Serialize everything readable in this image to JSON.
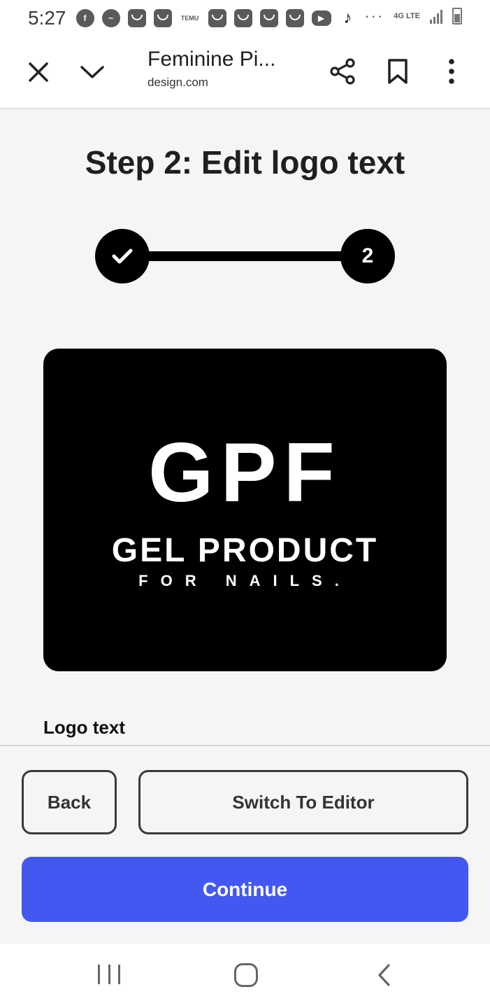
{
  "status_bar": {
    "time": "5:27",
    "notification_icons": [
      "facebook-icon",
      "messenger-icon",
      "temu-bag-icon",
      "temu-bag-icon",
      "temu-icon",
      "temu-bag-icon",
      "temu-bag-icon",
      "temu-bag-icon",
      "temu-bag-icon",
      "youtube-icon",
      "tiktok-icon"
    ],
    "temu_label": "TEMU",
    "more": "···",
    "network": "4G LTE"
  },
  "browser": {
    "title": "Feminine Pi...",
    "domain": "design.com"
  },
  "wizard": {
    "heading": "Step 2: Edit logo text",
    "step_two_label": "2"
  },
  "logo": {
    "monogram": "GPF",
    "name": "GEL PRODUCT",
    "tagline": "FOR NAILS."
  },
  "form": {
    "logo_text_label": "Logo text"
  },
  "actions": {
    "back_label": "Back",
    "editor_label": "Switch To Editor",
    "continue_label": "Continue"
  },
  "colors": {
    "primary": "#4358f0",
    "logo_background": "#000000",
    "page_background": "#f5f5f5"
  }
}
